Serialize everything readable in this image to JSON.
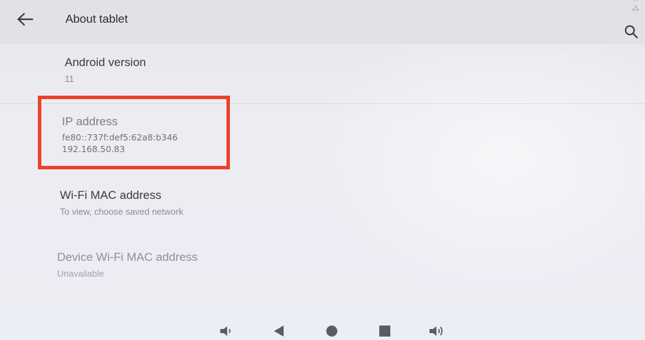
{
  "header": {
    "title": "About tablet",
    "back_icon": "arrow-left-icon",
    "search_icon": "search-icon"
  },
  "settings": [
    {
      "title": "Android version",
      "value": "11"
    },
    {
      "title": "IP address",
      "lines": [
        "fe80::737f:def5:62a8:b346",
        "192.168.50.83"
      ]
    },
    {
      "title": "Wi-Fi MAC address",
      "value": "To view, choose saved network"
    },
    {
      "title": "Device Wi-Fi MAC address",
      "value": "Unavailable"
    }
  ],
  "annotation": {
    "color": "#ee3f2a",
    "target": "IP address"
  },
  "navigation": {
    "buttons": [
      "volume-down-icon",
      "back-triangle-icon",
      "home-circle-icon",
      "recents-square-icon",
      "volume-up-icon"
    ]
  },
  "colors": {
    "background": "#ebebf2",
    "appbar": "#e1e1e6",
    "highlight": "#ee3f2a",
    "nav_icons": "#5a5c66"
  }
}
